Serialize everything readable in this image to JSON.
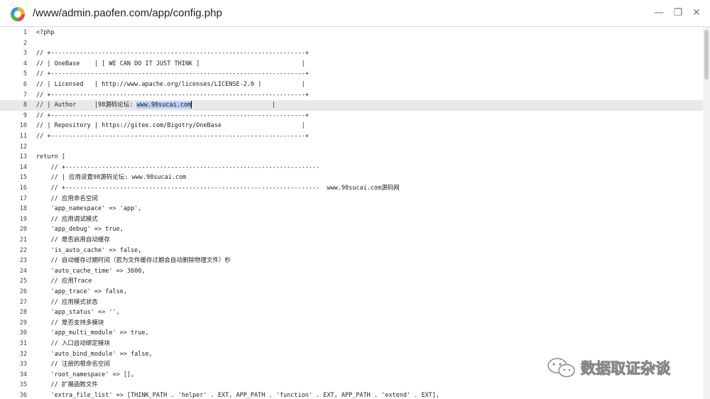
{
  "window": {
    "title": "/www/admin.paofen.com/app/config.php",
    "icon": "app-logo-icon",
    "controls": {
      "minimize": "—",
      "maximize": "❐",
      "close": "✕"
    }
  },
  "editor": {
    "highlighted_line": 8,
    "selection": "www.98sucai.com",
    "lines": [
      {
        "n": "1",
        "text": "<?php"
      },
      {
        "n": "2",
        "text": ""
      },
      {
        "n": "3",
        "text": "// +----------------------------------------------------------------------+"
      },
      {
        "n": "4",
        "text": "// | OneBase    | [ WE CAN DO IT JUST THINK ]                            |"
      },
      {
        "n": "5",
        "text": "// +----------------------------------------------------------------------+"
      },
      {
        "n": "6",
        "text": "// | Licensed   | http://www.apache.org/licenses/LICENSE-2.0 )           |"
      },
      {
        "n": "7",
        "text": "// +----------------------------------------------------------------------+"
      },
      {
        "n": "8",
        "text": "// | Author     |98源码论坛: ",
        "sel": "www.98sucai.com",
        "after": "                      |"
      },
      {
        "n": "9",
        "text": "// +----------------------------------------------------------------------+"
      },
      {
        "n": "10",
        "text": "// | Repository | https://gitee.com/Bigotry/OneBase                      |"
      },
      {
        "n": "11",
        "text": "// +----------------------------------------------------------------------+"
      },
      {
        "n": "12",
        "text": ""
      },
      {
        "n": "13",
        "text": "return ["
      },
      {
        "n": "14",
        "text": "    // +----------------------------------------------------------------------"
      },
      {
        "n": "15",
        "text": "    // | 应用设置98源码论坛: www.98sucai.com"
      },
      {
        "n": "16",
        "text": "    // +----------------------------------------------------------------------  www.98sucai.com源码网"
      },
      {
        "n": "17",
        "text": "    // 应用命名空间"
      },
      {
        "n": "18",
        "text": "    'app_namespace' => 'app',"
      },
      {
        "n": "19",
        "text": "    // 应用调试模式"
      },
      {
        "n": "20",
        "text": "    'app_debug' => true,"
      },
      {
        "n": "21",
        "text": "    // 是否启用自动缓存"
      },
      {
        "n": "22",
        "text": "    'is_auto_cache' => false,"
      },
      {
        "n": "23",
        "text": "    // 自动缓存过期时间（若为文件缓存过期会自动删除物理文件）秒"
      },
      {
        "n": "24",
        "text": "    'auto_cache_time' => 3600,"
      },
      {
        "n": "25",
        "text": "    // 应用Trace"
      },
      {
        "n": "26",
        "text": "    'app_trace' => false,"
      },
      {
        "n": "27",
        "text": "    // 应用模式状态"
      },
      {
        "n": "28",
        "text": "    'app_status' => '',"
      },
      {
        "n": "29",
        "text": "    // 是否支持多模块"
      },
      {
        "n": "30",
        "text": "    'app_multi_module' => true,"
      },
      {
        "n": "31",
        "text": "    // 入口自动绑定模块"
      },
      {
        "n": "32",
        "text": "    'auto_bind_module' => false,"
      },
      {
        "n": "33",
        "text": "    // 注册的根命名空间"
      },
      {
        "n": "34",
        "text": "    'root_namespace' => [],"
      },
      {
        "n": "35",
        "text": "    // 扩展函数文件"
      },
      {
        "n": "36",
        "text": "    'extra_file_list' => [THINK_PATH . 'helper' . EXT, APP_PATH . 'function' . EXT, APP_PATH . 'extend' . EXT],"
      }
    ]
  },
  "watermark": {
    "text": "数据取证杂谈",
    "icon": "wechat-icon"
  }
}
